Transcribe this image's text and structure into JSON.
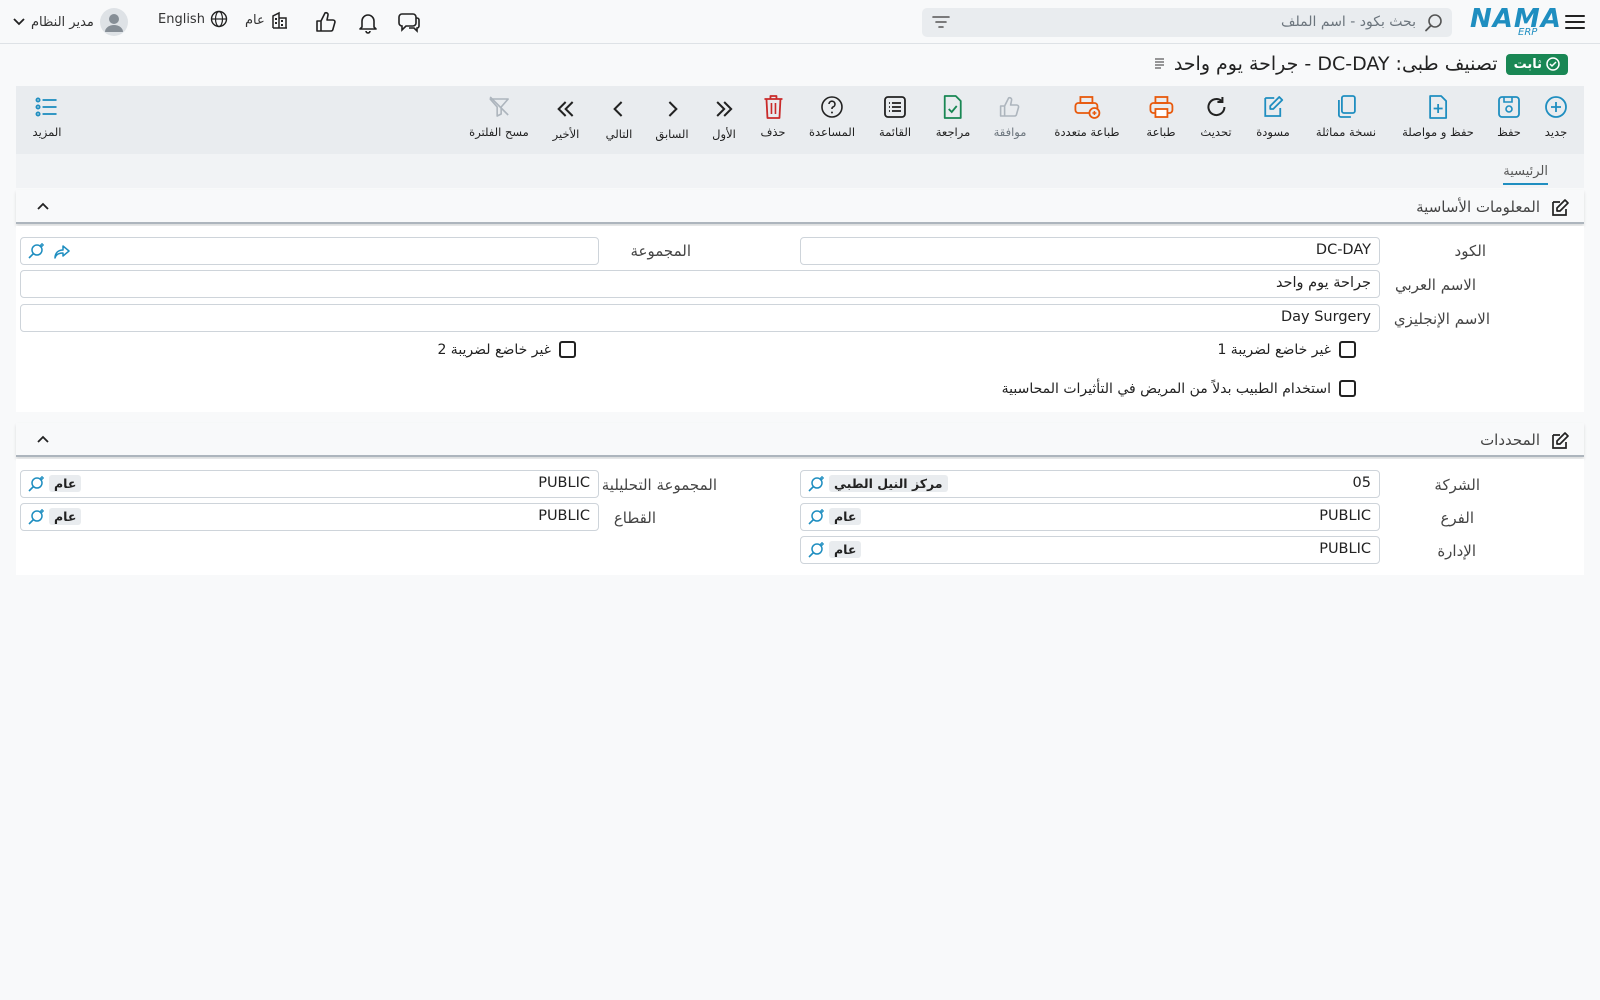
{
  "topbar": {
    "search_placeholder": "بحث بكود - اسم الملف",
    "logo_main": "NAMA",
    "logo_sub": "ERP",
    "user_name": "مدير النظام",
    "language": "English",
    "scope": "عام"
  },
  "title": {
    "text": "تصنيف طبى: DC-DAY - جراحة يوم واحد",
    "status": "ثابت"
  },
  "toolbar": {
    "new": "جديد",
    "save": "حفظ",
    "save_continue": "حفظ و مواصلة",
    "duplicate": "نسخة مماثلة",
    "draft": "مسودة",
    "refresh": "تحديث",
    "print": "طباعة",
    "multi_print": "طباعة متعددة",
    "approve": "موافقة",
    "review": "مراجعة",
    "list": "القائمة",
    "help": "المساعدة",
    "delete": "حذف",
    "first": "الأول",
    "previous": "السابق",
    "next": "التالي",
    "last": "الأخير",
    "clear_filter": "مسح الفلترة",
    "more": "المزيد"
  },
  "tabs": {
    "main": "الرئيسية"
  },
  "basic": {
    "title": "المعلومات الأساسية",
    "code_label": "الكود",
    "code_value": "DC-DAY",
    "group_label": "المجموعة",
    "arabic_name_label": "الاسم العربي",
    "arabic_name_value": "جراحة يوم واحد",
    "english_name_label": "الاسم الإنجليزي",
    "english_name_value": "Day Surgery",
    "tax1_label": "غير خاضع لضريبة 1",
    "tax2_label": "غير خاضع لضريبة 2",
    "doctor_label": "استخدام الطبيب بدلاً من المريض في التأثيرات المحاسبية"
  },
  "dimensions": {
    "title": "المحددات",
    "company_label": "الشركة",
    "company_code": "05",
    "company_name": "مركز النيل الطبي",
    "branch_label": "الفرع",
    "branch_code": "PUBLIC",
    "branch_name": "عام",
    "department_label": "الإدارة",
    "department_code": "PUBLIC",
    "department_name": "عام",
    "analysis_label": "المجموعة التحليلية",
    "analysis_code": "PUBLIC",
    "analysis_name": "عام",
    "sector_label": "القطاع",
    "sector_code": "PUBLIC",
    "sector_name": "عام"
  },
  "colors": {
    "accent": "#1f8ec0",
    "orange": "#e8590c",
    "green": "#198754",
    "red": "#c92a2a"
  }
}
